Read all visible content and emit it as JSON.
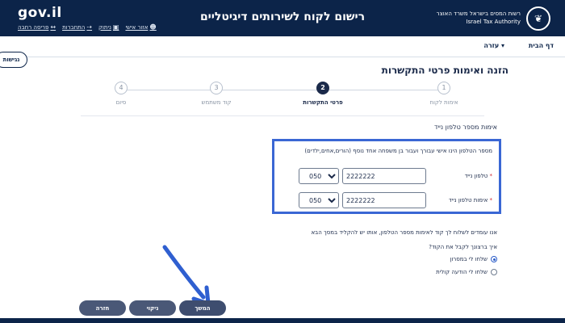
{
  "header": {
    "gov_logo": "gov.il",
    "links": [
      {
        "label": "אזור אישי",
        "icon": "user-icon"
      },
      {
        "label": "ניתוק",
        "icon": "lock-icon"
      },
      {
        "label": "התחברות",
        "icon": "login-icon"
      },
      {
        "label": "פריסה רחבה",
        "icon": "wide-layout-icon"
      }
    ],
    "app_title": "רישום לקוח לשירותים דיגיטליים",
    "authority_he": "רשות המסים בישראל משרד האוצר",
    "authority_en": "Israel Tax Authority",
    "emblem": "menorah-emblem-icon"
  },
  "nav": {
    "home": "דף הבית",
    "help": "עזרה ▾",
    "accessibility": "נגישות"
  },
  "page_title": "הזנה ואימות פרטי התקשרות",
  "stepper": {
    "steps": [
      {
        "num": "1",
        "label": "אימות לקוח"
      },
      {
        "num": "2",
        "label": "פרטי התקשרות"
      },
      {
        "num": "3",
        "label": "קוד משתמש"
      },
      {
        "num": "4",
        "label": "סיום"
      }
    ],
    "active_index": 1
  },
  "section_title": "אימות מספר טלפון נייד",
  "phone": {
    "hint": "מספר הטלפון הינו אישי עבורך ועבור בן משפחה אחד נוסף (הורים,אחים,ילדים)",
    "mobile_label": "טלפון נייד",
    "mobile_prefix": "050",
    "mobile_number": "2222222",
    "confirm_label": "אימות טלפון נייד",
    "confirm_prefix": "050",
    "confirm_number": "2222222",
    "required_mark": "*"
  },
  "note": "אנו עומדים לשלוח לך קוד לאימות מספר הטלפון, אותו יש להקליד במסך הבא",
  "question": "איך ברצונך לקבל את הקוד?",
  "options": {
    "sms": "שלחו לי במסרון",
    "voice": "שלחו לי הודעה קולית",
    "selected": "sms"
  },
  "buttons": {
    "next": "המשך",
    "clear": "ניקוי",
    "back": "חזרה"
  },
  "colors": {
    "header_bg": "#0c2449",
    "highlight_border": "#3a67d4",
    "button_bg": "#4a5877",
    "arrow": "#2f5fd0"
  }
}
